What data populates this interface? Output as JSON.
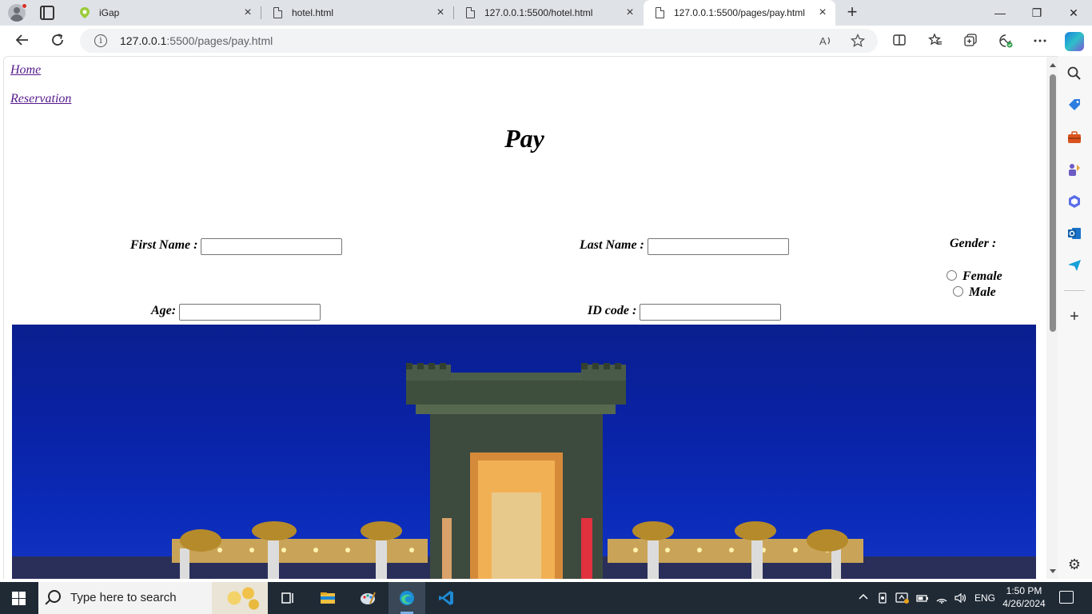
{
  "browser": {
    "tabs": [
      {
        "label": "iGap",
        "icon": "igap-icon"
      },
      {
        "label": "hotel.html",
        "icon": "file-icon"
      },
      {
        "label": "127.0.0.1:5500/hotel.html",
        "icon": "file-icon"
      },
      {
        "label": "127.0.0.1:5500/pages/pay.html",
        "icon": "file-icon",
        "active": true
      }
    ],
    "address": {
      "host": "127.0.0.1",
      "path": ":5500/pages/pay.html"
    },
    "window_controls": {
      "minimize": "—",
      "restore": "❐",
      "close": "✕"
    }
  },
  "page": {
    "nav_links": [
      "Home",
      "Reservation"
    ],
    "title": "Pay",
    "form": {
      "first_name_label": "First Name :",
      "last_name_label": "Last Name :",
      "gender_label": "Gender :",
      "gender_options": [
        "Female",
        "Male"
      ],
      "age_label": "Age:",
      "id_code_label": "ID code :"
    }
  },
  "taskbar": {
    "search_placeholder": "Type here to search",
    "language": "ENG",
    "time": "1:50 PM",
    "date": "4/26/2024"
  },
  "colors": {
    "link": "#551a8b",
    "hero_sky": "#0a22a3",
    "taskbar": "#1f2a35"
  }
}
